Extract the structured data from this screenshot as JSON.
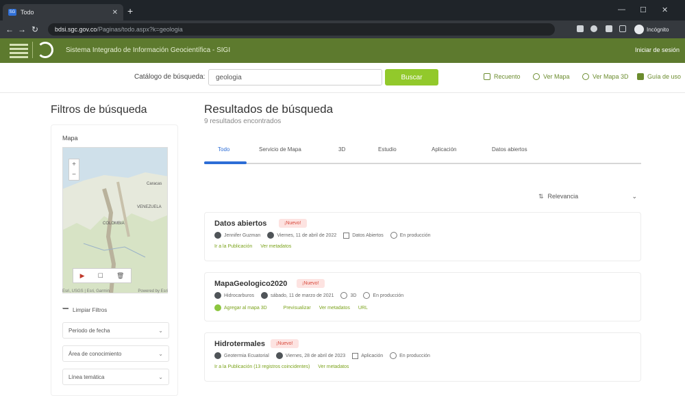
{
  "browser": {
    "tab_title": "Todo",
    "url_host": "bdsi.sgc.gov.co",
    "url_path": "/Paginas/todo.aspx?k=geologia",
    "profile_label": "Incógnito"
  },
  "header": {
    "site_title": "Sistema Integrado de Información Geocientífica - SIGI",
    "signin_label": "Iniciar de sesión"
  },
  "search": {
    "catalog_label": "Catálogo de búsqueda:",
    "query": "geologia",
    "button_label": "Buscar",
    "links": [
      "Recuento",
      "Ver Mapa",
      "Ver Mapa 3D",
      "Guía de uso"
    ]
  },
  "filters": {
    "title": "Filtros de búsqueda",
    "map_label": "Mapa",
    "map_places": [
      "VENEZUELA",
      "COLOMBIA",
      "Caracas"
    ],
    "map_credit_left": "Esri, USGS | Esri, Garmin",
    "map_credit_right": "Powered by Esri",
    "clear_label": "Limpiar Filtros",
    "dropdowns": [
      "Periodo de fecha",
      "Área de conocimiento",
      "Línea temática"
    ]
  },
  "results": {
    "title": "Resultados de búsqueda",
    "count": "9 resultados encontrados",
    "tabs": [
      "Todo",
      "Servicio de Mapa",
      "3D",
      "Estudio",
      "Aplicación",
      "Datos abiertos"
    ],
    "active_tab": 0,
    "sort_label": "Relevancia",
    "new_badge": "¡Nuevo!",
    "cards": [
      {
        "title": "Datos abiertos",
        "meta": [
          "Jennifer Guzman",
          "Viernes, 11 de abril de 2022",
          "Datos Abiertos",
          "En producción"
        ],
        "links": [
          "Ir a la Publicación",
          "Ver metadatos"
        ]
      },
      {
        "title": "MapaGeologico2020",
        "meta": [
          "Hidrocarburos",
          "sábado, 11 de marzo de 2021",
          "3D",
          "En producción"
        ],
        "links": [
          "Agregar al mapa 3D",
          "Previsualizar",
          "Ver metadatos",
          "URL"
        ]
      },
      {
        "title": "Hidrotermales",
        "meta": [
          "Geotermia Ecuatorial",
          "Viernes, 28 de abril de 2023",
          "Aplicación",
          "En producción"
        ],
        "links": [
          "Ir a la Publicación (13 registros coincidentes)",
          "Ver metadatos"
        ]
      }
    ]
  }
}
